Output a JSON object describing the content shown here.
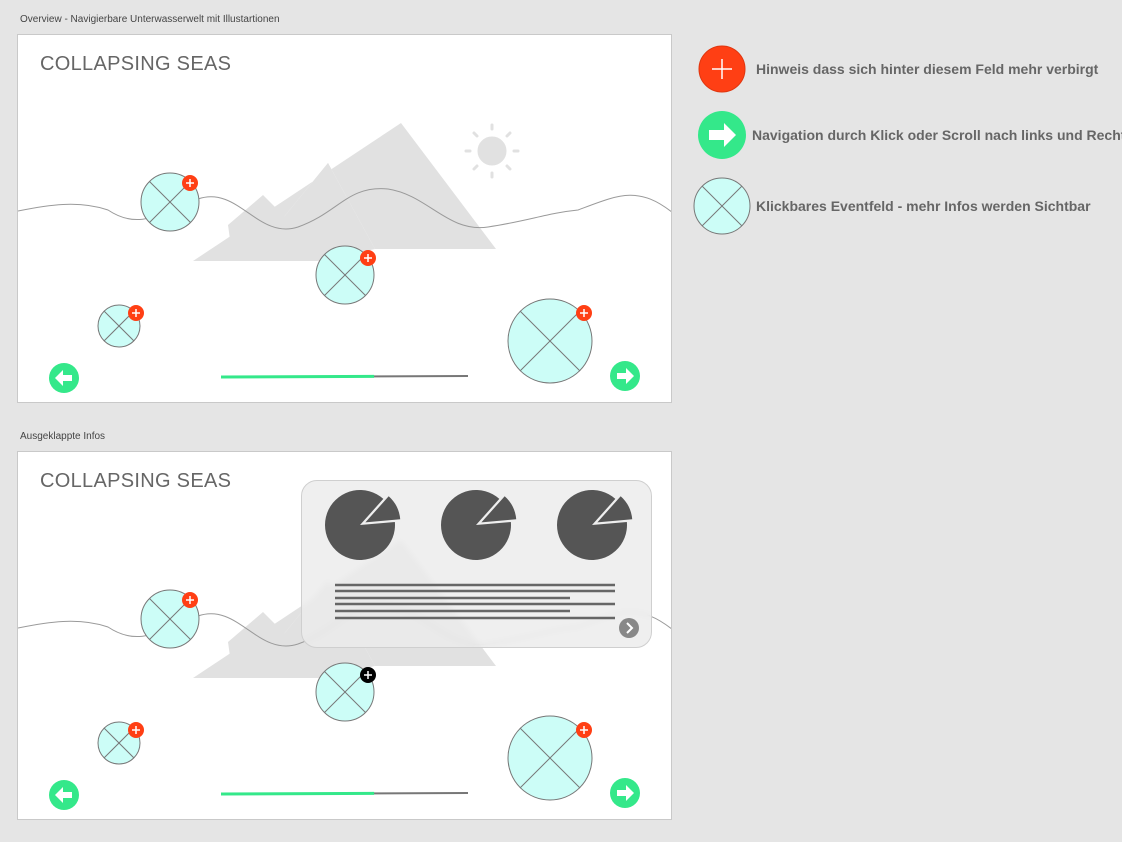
{
  "artboards": [
    {
      "label": "Overview - Navigierbare Unterwasserwelt mit Illustartionen",
      "title": "COLLAPSING SEAS",
      "progress": 0.62,
      "hint_badge_color": "#ff3f14",
      "hint_badge_active": false
    },
    {
      "label": "Ausgeklappte Infos",
      "title": "COLLAPSING SEAS",
      "progress": 0.62,
      "hint_badge_color": "#ff3f14",
      "hint_badge_active": true
    }
  ],
  "legend": {
    "hint": "Hinweis dass sich hinter diesem Feld mehr verbirgt",
    "navigation": "Navigation durch Klick oder Scroll nach links und Rechts",
    "event_field": "Klickbares Eventfeld - mehr Infos werden Sichtbar"
  },
  "colors": {
    "hint_red": "#ff3f14",
    "nav_green": "#34e88a",
    "event_cyan": "#ccfdf7",
    "progress_green": "#34e88a",
    "pie_dark": "#555555",
    "active_badge": "#000000"
  },
  "icons": {
    "hint": "plus-icon",
    "navigation": "arrow-right-icon",
    "event_field": "event-field-placeholder-icon",
    "prev": "arrow-left-icon",
    "next": "arrow-right-icon",
    "sun": "sun-icon",
    "mountains": "mountain-illustration",
    "pie": "pie-chart-icon",
    "panel_next": "chevron-right-icon"
  },
  "info_panel": {
    "charts": [
      {
        "share": 0.88
      },
      {
        "share": 0.88
      },
      {
        "share": 0.88
      }
    ]
  }
}
